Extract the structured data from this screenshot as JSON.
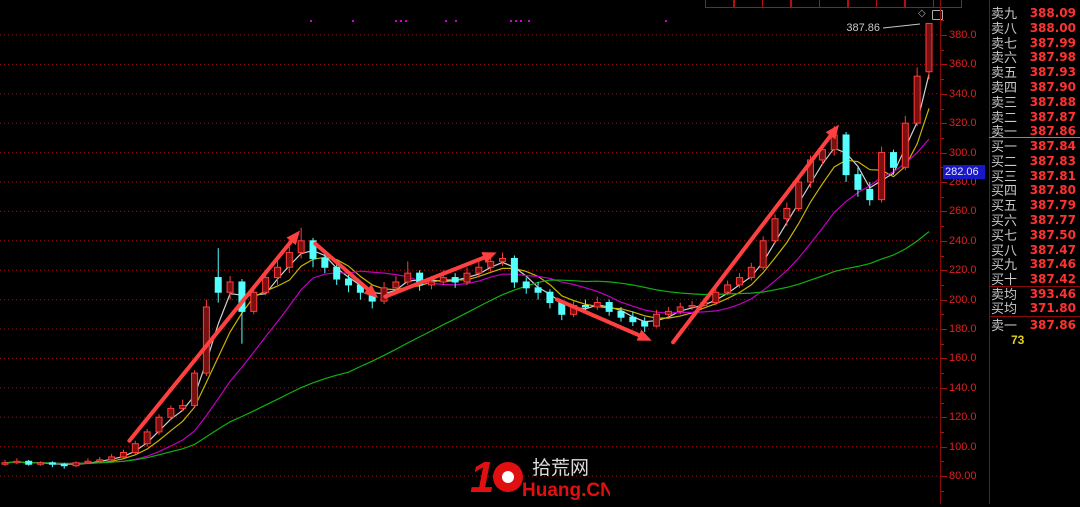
{
  "toolbar": {
    "tab_count": 9
  },
  "price_axis": {
    "labels": [
      "380.0",
      "360.0",
      "340.0",
      "320.0",
      "300.0",
      "280.0",
      "260.0",
      "240.0",
      "220.0",
      "200.0",
      "180.0",
      "160.0",
      "140.0",
      "120.0",
      "100.0",
      "80.00"
    ],
    "current_price_box": "282.06"
  },
  "last_price_label": "387.86",
  "order_book": {
    "asks": [
      {
        "label": "卖九",
        "price": "388.09"
      },
      {
        "label": "卖八",
        "price": "388.00"
      },
      {
        "label": "卖七",
        "price": "387.99"
      },
      {
        "label": "卖六",
        "price": "387.98"
      },
      {
        "label": "卖五",
        "price": "387.93"
      },
      {
        "label": "卖四",
        "price": "387.90"
      },
      {
        "label": "卖三",
        "price": "387.88"
      },
      {
        "label": "卖二",
        "price": "387.87"
      },
      {
        "label": "卖一",
        "price": "387.86"
      }
    ],
    "bids": [
      {
        "label": "买一",
        "price": "387.84"
      },
      {
        "label": "买二",
        "price": "387.83"
      },
      {
        "label": "买三",
        "price": "387.81"
      },
      {
        "label": "买四",
        "price": "387.80"
      },
      {
        "label": "买五",
        "price": "387.79"
      },
      {
        "label": "买六",
        "price": "387.77"
      },
      {
        "label": "买七",
        "price": "387.50"
      },
      {
        "label": "买八",
        "price": "387.47"
      },
      {
        "label": "买九",
        "price": "387.46"
      },
      {
        "label": "买十",
        "price": "387.42"
      }
    ],
    "avg_ask": {
      "label": "卖均",
      "price": "393.46"
    },
    "avg_bid": {
      "label": "买均",
      "price": "371.80"
    },
    "last": {
      "label": "卖一",
      "price": "387.86"
    },
    "volume": "73"
  },
  "logo": {
    "number": "10",
    "cn": "拾荒网",
    "en": "Huang.CN"
  },
  "colors": {
    "up": "#ff3c3c",
    "down": "#54ffff",
    "grid": "#a01010",
    "ma_white": "#d0d0d0",
    "ma_yellow": "#c8b400",
    "ma_magenta": "#c000c0",
    "ma_green": "#10b010",
    "arrow": "#ff4040"
  },
  "chart_data": {
    "type": "candlestick",
    "ylim": [
      70,
      390
    ],
    "grid": true,
    "y_ticks": [
      80,
      100,
      120,
      140,
      160,
      180,
      200,
      220,
      240,
      260,
      280,
      300,
      320,
      340,
      360,
      380
    ],
    "ohlc": [
      [
        88,
        91,
        87,
        89
      ],
      [
        89,
        92,
        88,
        90
      ],
      [
        90,
        91,
        87,
        88
      ],
      [
        88,
        90,
        87,
        89
      ],
      [
        89,
        90,
        86,
        88
      ],
      [
        88,
        89,
        85,
        87
      ],
      [
        87,
        90,
        86,
        89
      ],
      [
        89,
        92,
        88,
        90
      ],
      [
        90,
        93,
        89,
        91
      ],
      [
        91,
        95,
        90,
        93
      ],
      [
        93,
        98,
        92,
        96
      ],
      [
        96,
        104,
        95,
        102
      ],
      [
        102,
        112,
        100,
        110
      ],
      [
        110,
        122,
        108,
        120
      ],
      [
        120,
        128,
        118,
        126
      ],
      [
        126,
        132,
        124,
        128
      ],
      [
        128,
        152,
        127,
        150
      ],
      [
        150,
        200,
        148,
        195
      ],
      [
        215,
        235,
        198,
        205
      ],
      [
        205,
        216,
        200,
        212
      ],
      [
        212,
        214,
        170,
        192
      ],
      [
        192,
        208,
        190,
        205
      ],
      [
        205,
        220,
        203,
        215
      ],
      [
        215,
        226,
        210,
        222
      ],
      [
        222,
        238,
        218,
        232
      ],
      [
        232,
        249,
        228,
        240
      ],
      [
        240,
        242,
        222,
        228
      ],
      [
        228,
        232,
        218,
        222
      ],
      [
        222,
        226,
        210,
        214
      ],
      [
        214,
        218,
        205,
        210
      ],
      [
        210,
        212,
        200,
        205
      ],
      [
        205,
        207,
        194,
        199
      ],
      [
        199,
        212,
        197,
        208
      ],
      [
        208,
        216,
        204,
        212
      ],
      [
        212,
        226,
        210,
        218
      ],
      [
        218,
        220,
        206,
        210
      ],
      [
        210,
        216,
        207,
        212
      ],
      [
        212,
        220,
        210,
        215
      ],
      [
        215,
        218,
        208,
        212
      ],
      [
        212,
        222,
        210,
        218
      ],
      [
        218,
        226,
        215,
        222
      ],
      [
        222,
        229,
        219,
        226
      ],
      [
        226,
        232,
        223,
        228
      ],
      [
        228,
        230,
        208,
        212
      ],
      [
        212,
        215,
        204,
        208
      ],
      [
        208,
        212,
        200,
        205
      ],
      [
        205,
        207,
        194,
        198
      ],
      [
        198,
        200,
        186,
        190
      ],
      [
        190,
        199,
        188,
        196
      ],
      [
        196,
        200,
        192,
        195
      ],
      [
        195,
        202,
        193,
        198
      ],
      [
        198,
        200,
        189,
        192
      ],
      [
        192,
        195,
        185,
        188
      ],
      [
        188,
        192,
        182,
        185
      ],
      [
        185,
        188,
        178,
        182
      ],
      [
        182,
        193,
        181,
        190
      ],
      [
        190,
        195,
        188,
        192
      ],
      [
        192,
        198,
        190,
        195
      ],
      [
        195,
        199,
        193,
        196
      ],
      [
        196,
        201,
        194,
        198
      ],
      [
        198,
        207,
        196,
        205
      ],
      [
        205,
        213,
        203,
        210
      ],
      [
        210,
        218,
        208,
        215
      ],
      [
        215,
        225,
        213,
        222
      ],
      [
        222,
        243,
        220,
        240
      ],
      [
        240,
        258,
        238,
        255
      ],
      [
        255,
        266,
        250,
        262
      ],
      [
        262,
        284,
        260,
        280
      ],
      [
        280,
        298,
        276,
        295
      ],
      [
        295,
        306,
        292,
        302
      ],
      [
        302,
        318,
        298,
        312
      ],
      [
        312,
        314,
        280,
        285
      ],
      [
        285,
        290,
        270,
        275
      ],
      [
        275,
        280,
        264,
        268
      ],
      [
        268,
        304,
        266,
        300
      ],
      [
        300,
        302,
        285,
        290
      ],
      [
        290,
        325,
        288,
        320
      ],
      [
        320,
        358,
        318,
        352
      ],
      [
        355,
        388.09,
        350,
        387.86
      ]
    ],
    "moving_averages": [
      {
        "window": 3,
        "color": "#d0d0d0"
      },
      {
        "window": 5,
        "color": "#c8b400"
      },
      {
        "window": 10,
        "color": "#c000c0"
      },
      {
        "window": 30,
        "color": "#10b010"
      }
    ],
    "annotations": [
      {
        "type": "arrow",
        "from": [
          10.5,
          104
        ],
        "to": [
          24.9,
          247
        ]
      },
      {
        "type": "arrow",
        "from": [
          26.2,
          238
        ],
        "to": [
          31.5,
          201
        ]
      },
      {
        "type": "arrow",
        "from": [
          32.1,
          202
        ],
        "to": [
          41.5,
          232
        ]
      },
      {
        "type": "arrow",
        "from": [
          46.6,
          200
        ],
        "to": [
          54.6,
          172
        ]
      },
      {
        "type": "arrow",
        "from": [
          56.4,
          171
        ],
        "to": [
          70.4,
          319
        ]
      }
    ]
  }
}
